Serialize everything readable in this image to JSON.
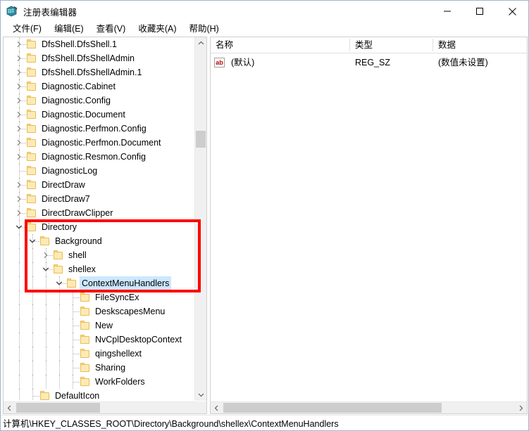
{
  "window": {
    "title": "注册表编辑器",
    "icon": "registry-editor-icon",
    "controls": {
      "minimize": "─",
      "maximize": "□",
      "close": "✕"
    }
  },
  "menubar": {
    "items": [
      {
        "label": "文件(F)"
      },
      {
        "label": "编辑(E)"
      },
      {
        "label": "查看(V)"
      },
      {
        "label": "收藏夹(A)"
      },
      {
        "label": "帮助(H)"
      }
    ]
  },
  "tree": {
    "rows": [
      {
        "label": "DfsShell.DfsShell.1",
        "level": 1,
        "state": "collapsed",
        "selected": false
      },
      {
        "label": "DfsShell.DfsShellAdmin",
        "level": 1,
        "state": "collapsed",
        "selected": false
      },
      {
        "label": "DfsShell.DfsShellAdmin.1",
        "level": 1,
        "state": "collapsed",
        "selected": false
      },
      {
        "label": "Diagnostic.Cabinet",
        "level": 1,
        "state": "collapsed",
        "selected": false
      },
      {
        "label": "Diagnostic.Config",
        "level": 1,
        "state": "collapsed",
        "selected": false
      },
      {
        "label": "Diagnostic.Document",
        "level": 1,
        "state": "collapsed",
        "selected": false
      },
      {
        "label": "Diagnostic.Perfmon.Config",
        "level": 1,
        "state": "collapsed",
        "selected": false
      },
      {
        "label": "Diagnostic.Perfmon.Document",
        "level": 1,
        "state": "collapsed",
        "selected": false
      },
      {
        "label": "Diagnostic.Resmon.Config",
        "level": 1,
        "state": "collapsed",
        "selected": false
      },
      {
        "label": "DiagnosticLog",
        "level": 1,
        "state": "leaf",
        "selected": false
      },
      {
        "label": "DirectDraw",
        "level": 1,
        "state": "collapsed",
        "selected": false
      },
      {
        "label": "DirectDraw7",
        "level": 1,
        "state": "collapsed",
        "selected": false
      },
      {
        "label": "DirectDrawClipper",
        "level": 1,
        "state": "collapsed",
        "selected": false
      },
      {
        "label": "Directory",
        "level": 1,
        "state": "expanded",
        "selected": false
      },
      {
        "label": "Background",
        "level": 2,
        "state": "expanded",
        "selected": false
      },
      {
        "label": "shell",
        "level": 3,
        "state": "collapsed",
        "selected": false
      },
      {
        "label": "shellex",
        "level": 3,
        "state": "expanded",
        "selected": false
      },
      {
        "label": "ContextMenuHandlers",
        "level": 4,
        "state": "expanded",
        "selected": true
      },
      {
        "label": "FileSyncEx",
        "level": 5,
        "state": "leaf",
        "selected": false
      },
      {
        "label": "DeskscapesMenu",
        "level": 5,
        "state": "leaf",
        "selected": false
      },
      {
        "label": "New",
        "level": 5,
        "state": "leaf",
        "selected": false
      },
      {
        "label": "NvCplDesktopContext",
        "level": 5,
        "state": "leaf",
        "selected": false
      },
      {
        "label": "qingshellext",
        "level": 5,
        "state": "leaf",
        "selected": false
      },
      {
        "label": "Sharing",
        "level": 5,
        "state": "leaf",
        "selected": false
      },
      {
        "label": "WorkFolders",
        "level": 5,
        "state": "leaf",
        "selected": false
      },
      {
        "label": "DefaultIcon",
        "level": 2,
        "state": "leaf",
        "selected": false
      }
    ],
    "scroll": {
      "vertical_thumb_label": "tree-vertical-scroll-thumb",
      "horizontal_thumb_label": "tree-horizontal-scroll-thumb"
    }
  },
  "list": {
    "columns": [
      {
        "label": "名称"
      },
      {
        "label": "类型"
      },
      {
        "label": "数据"
      }
    ],
    "rows": [
      {
        "icon": "string-value-icon",
        "icon_text": "ab",
        "name": "(默认)",
        "type": "REG_SZ",
        "data": "(数值未设置)"
      }
    ]
  },
  "statusbar": {
    "path": "计算机\\HKEY_CLASSES_ROOT\\Directory\\Background\\shellex\\ContextMenuHandlers"
  },
  "annotation": {
    "color": "#ff0000",
    "label": "highlight-rectangle"
  }
}
